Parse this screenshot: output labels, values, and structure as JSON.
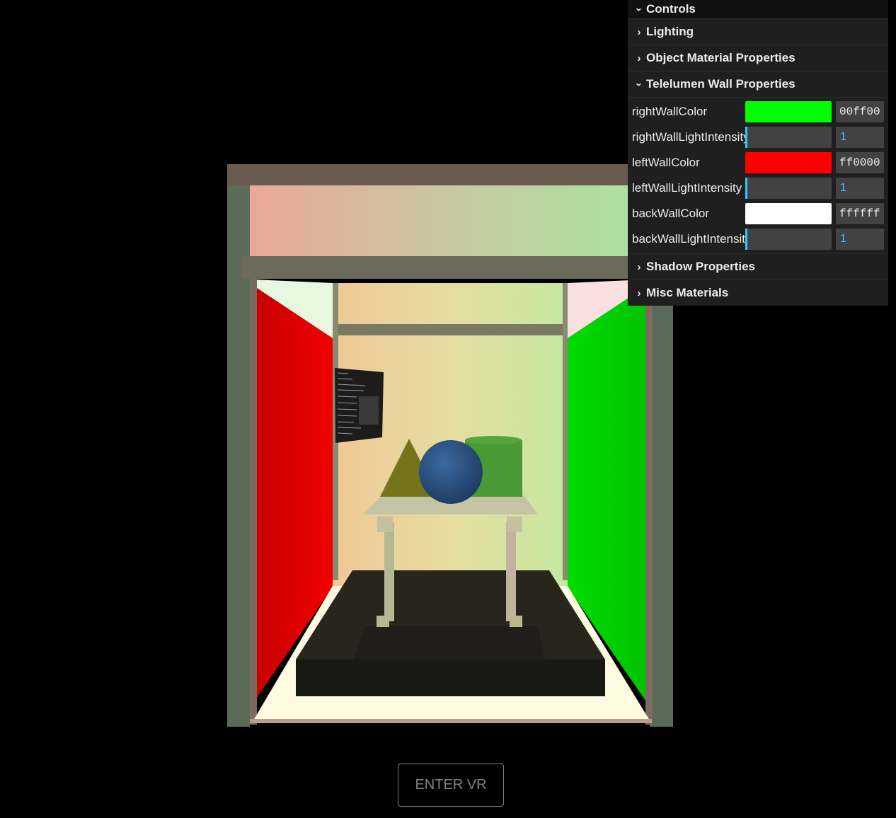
{
  "gui": {
    "title": "Controls",
    "folders": {
      "lighting": "Lighting",
      "object_material": "Object Material Properties",
      "telelumen": "Telelumen Wall Properties",
      "shadow": "Shadow Properties",
      "misc": "Misc Materials"
    },
    "wall": {
      "rightWallColor": {
        "label": "rightWallColor",
        "hex": "00ff00",
        "color": "#00ff00"
      },
      "rightWallLightIntensity": {
        "label": "rightWallLightIntensity",
        "value": "1",
        "fraction": 0.02
      },
      "leftWallColor": {
        "label": "leftWallColor",
        "hex": "ff0000",
        "color": "#ff0000"
      },
      "leftWallLightIntensity": {
        "label": "leftWallLightIntensity",
        "value": "1",
        "fraction": 0.02
      },
      "backWallColor": {
        "label": "backWallColor",
        "hex": "ffffff",
        "color": "#ffffff"
      },
      "backWallLightIntensity": {
        "label": "backWallLightIntensity",
        "value": "1",
        "fraction": 0.02
      }
    },
    "icons": {
      "expanded": "chevron-down-icon",
      "collapsed": "chevron-right-icon"
    }
  },
  "vr_button": {
    "label": "ENTER VR"
  }
}
